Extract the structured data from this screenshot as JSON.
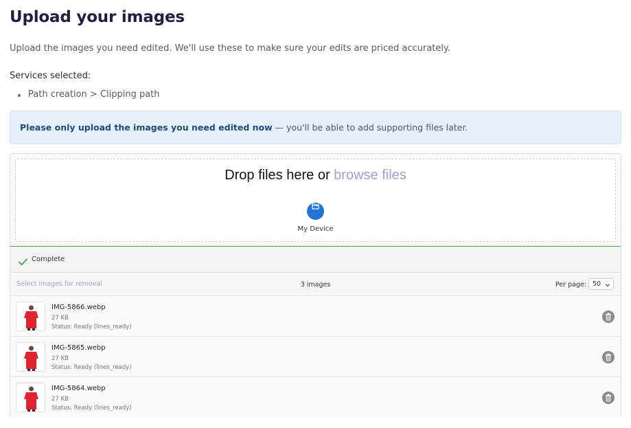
{
  "page": {
    "title": "Upload your images",
    "intro": "Upload the images you need edited. We'll use these to make sure your edits are priced accurately.",
    "services_label": "Services selected:",
    "services": [
      "Path creation > Clipping path"
    ]
  },
  "notice": {
    "bold": "Please only upload the images you need edited now",
    "rest": " — you'll be able to add supporting files later."
  },
  "uploader": {
    "drop_text": "Drop files here or ",
    "browse_label": "browse files",
    "device_label": "My Device",
    "device_icon": "folder-icon",
    "status": "Complete",
    "status_icon": "check-icon",
    "status_color": "#3aa74e",
    "select_removal": "Select images for removal",
    "image_count": "3 images",
    "per_page_label": "Per page:",
    "per_page_value": "50"
  },
  "files": [
    {
      "name": "IMG-5866.webp",
      "size": "27 KB",
      "status": "Status: Ready (lines_ready)"
    },
    {
      "name": "IMG-5865.webp",
      "size": "27 KB",
      "status": "Status: Ready (lines_ready)"
    },
    {
      "name": "IMG-5864.webp",
      "size": "27 KB",
      "status": "Status: Ready (lines_ready)"
    }
  ],
  "colors": {
    "accent_link": "#a99ad8",
    "device_button": "#2275d7",
    "notice_bg": "#e5f0fa"
  }
}
